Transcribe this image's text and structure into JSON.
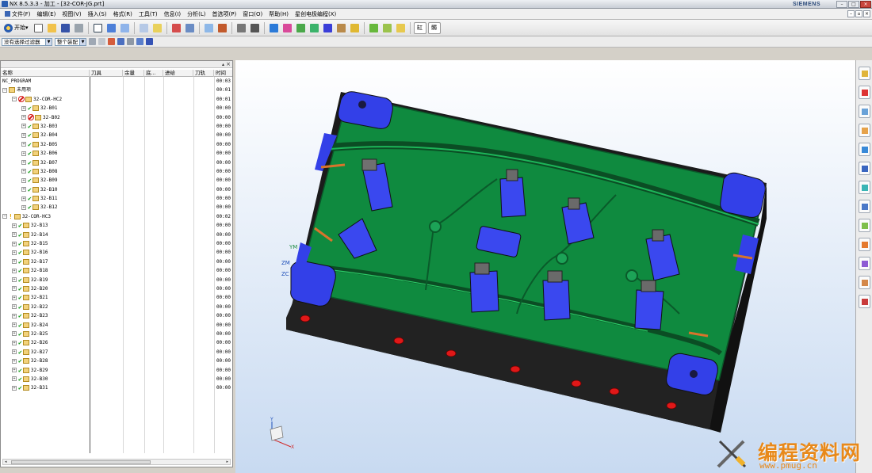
{
  "window": {
    "title": "NX 8.5.3.3 - 加工 - [32-COR-JG.prt]",
    "brand": "SIEMENS"
  },
  "menu": [
    "文件(F)",
    "编辑(E)",
    "视图(V)",
    "插入(S)",
    "格式(R)",
    "工具(T)",
    "信息(I)",
    "分析(L)",
    "首选项(P)",
    "窗口(O)",
    "帮助(H)",
    "星创电极编程(X)"
  ],
  "toolbar": {
    "start_label": "开始",
    "custom_labels": [
      "缸",
      "髑"
    ]
  },
  "filter": {
    "selection_filter": "没有选择过滤器",
    "assembly_scope": "整个装配"
  },
  "navigator": {
    "columns": [
      "名称",
      "刀具",
      "余量",
      "底...",
      "进给",
      "刀轨",
      "时间"
    ],
    "rows": [
      {
        "name": "NC_PROGRAM",
        "time": "00:03",
        "level": 0,
        "exp": "",
        "status": "none",
        "folder": false
      },
      {
        "name": "未用项",
        "time": "00:01",
        "level": 0,
        "exp": "-",
        "status": "none",
        "folder": true
      },
      {
        "name": "32-COR-HC2",
        "time": "00:01",
        "level": 1,
        "exp": "-",
        "status": "no",
        "folder": true
      },
      {
        "name": "32-B01",
        "time": "00:00",
        "level": 2,
        "exp": "+",
        "status": "ok",
        "folder": true
      },
      {
        "name": "32-B02",
        "time": "00:00",
        "level": 2,
        "exp": "+",
        "status": "no",
        "folder": true
      },
      {
        "name": "32-B03",
        "time": "00:00",
        "level": 2,
        "exp": "+",
        "status": "ok",
        "folder": true
      },
      {
        "name": "32-B04",
        "time": "00:00",
        "level": 2,
        "exp": "+",
        "status": "ok",
        "folder": true
      },
      {
        "name": "32-B05",
        "time": "00:00",
        "level": 2,
        "exp": "+",
        "status": "ok",
        "folder": true
      },
      {
        "name": "32-B06",
        "time": "00:00",
        "level": 2,
        "exp": "+",
        "status": "ok",
        "folder": true
      },
      {
        "name": "32-B07",
        "time": "00:00",
        "level": 2,
        "exp": "+",
        "status": "ok",
        "folder": true
      },
      {
        "name": "32-B08",
        "time": "00:00",
        "level": 2,
        "exp": "+",
        "status": "ok",
        "folder": true
      },
      {
        "name": "32-B09",
        "time": "00:00",
        "level": 2,
        "exp": "+",
        "status": "ok",
        "folder": true
      },
      {
        "name": "32-B10",
        "time": "00:00",
        "level": 2,
        "exp": "+",
        "status": "ok",
        "folder": true
      },
      {
        "name": "32-B11",
        "time": "00:00",
        "level": 2,
        "exp": "+",
        "status": "ok",
        "folder": true
      },
      {
        "name": "32-B12",
        "time": "00:00",
        "level": 2,
        "exp": "+",
        "status": "ok",
        "folder": true
      },
      {
        "name": "32-COR-HC3",
        "time": "00:02",
        "level": 0,
        "exp": "-",
        "status": "warn",
        "folder": true
      },
      {
        "name": "32-B13",
        "time": "00:00",
        "level": 1,
        "exp": "+",
        "status": "ok",
        "folder": true
      },
      {
        "name": "32-B14",
        "time": "00:00",
        "level": 1,
        "exp": "+",
        "status": "ok",
        "folder": true
      },
      {
        "name": "32-B15",
        "time": "00:00",
        "level": 1,
        "exp": "+",
        "status": "ok",
        "folder": true
      },
      {
        "name": "32-B16",
        "time": "00:00",
        "level": 1,
        "exp": "+",
        "status": "ok",
        "folder": true
      },
      {
        "name": "32-B17",
        "time": "00:00",
        "level": 1,
        "exp": "+",
        "status": "ok",
        "folder": true
      },
      {
        "name": "32-B18",
        "time": "00:00",
        "level": 1,
        "exp": "+",
        "status": "ok",
        "folder": true
      },
      {
        "name": "32-B19",
        "time": "00:00",
        "level": 1,
        "exp": "+",
        "status": "ok",
        "folder": true
      },
      {
        "name": "32-B20",
        "time": "00:00",
        "level": 1,
        "exp": "+",
        "status": "ok",
        "folder": true
      },
      {
        "name": "32-B21",
        "time": "00:00",
        "level": 1,
        "exp": "+",
        "status": "ok",
        "folder": true
      },
      {
        "name": "32-B22",
        "time": "00:00",
        "level": 1,
        "exp": "+",
        "status": "ok",
        "folder": true
      },
      {
        "name": "32-B23",
        "time": "00:00",
        "level": 1,
        "exp": "+",
        "status": "ok",
        "folder": true
      },
      {
        "name": "32-B24",
        "time": "00:00",
        "level": 1,
        "exp": "+",
        "status": "ok",
        "folder": true
      },
      {
        "name": "32-B25",
        "time": "00:00",
        "level": 1,
        "exp": "+",
        "status": "ok",
        "folder": true
      },
      {
        "name": "32-B26",
        "time": "00:00",
        "level": 1,
        "exp": "+",
        "status": "ok",
        "folder": true
      },
      {
        "name": "32-B27",
        "time": "00:00",
        "level": 1,
        "exp": "+",
        "status": "ok",
        "folder": true
      },
      {
        "name": "32-B28",
        "time": "00:00",
        "level": 1,
        "exp": "+",
        "status": "ok",
        "folder": true
      },
      {
        "name": "32-B29",
        "time": "00:00",
        "level": 1,
        "exp": "+",
        "status": "ok",
        "folder": true
      },
      {
        "name": "32-B30",
        "time": "00:00",
        "level": 1,
        "exp": "+",
        "status": "ok",
        "folder": true
      },
      {
        "name": "32-B31",
        "time": "00:00",
        "level": 1,
        "exp": "+",
        "status": "ok",
        "folder": true
      }
    ]
  },
  "viewport": {
    "csys_labels": {
      "ym": "YM",
      "zm": "ZM",
      "zc": "ZC",
      "y": "Y",
      "x": "X"
    },
    "colors": {
      "plate": "#1c1c1c",
      "green": "#0f8a3f",
      "blue": "#3340e8",
      "holes": "#e01818",
      "background_bottom": "#c8daf1"
    }
  },
  "watermark": {
    "text": "编程资料网",
    "url": "www.pmug.cn"
  }
}
